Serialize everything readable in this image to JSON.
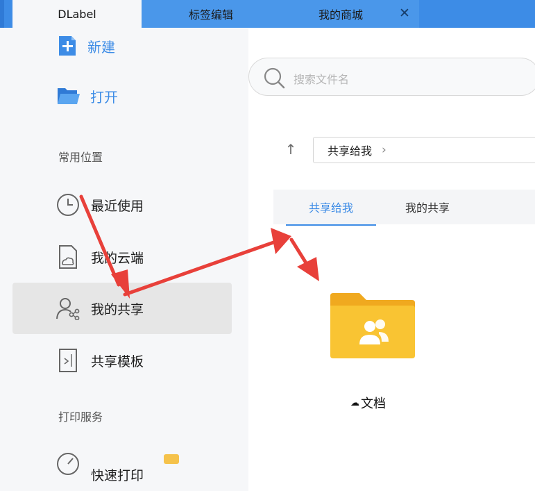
{
  "tabs": {
    "home": "DLabel",
    "label_edit": "标签编辑",
    "mall": "我的商城",
    "close_glyph": "✕"
  },
  "sidebar": {
    "new_label": "新建",
    "open_label": "打开",
    "section_common": "常用位置",
    "items": [
      {
        "label": "最近使用",
        "icon": "clock-icon"
      },
      {
        "label": "我的云端",
        "icon": "cloud-file-icon"
      },
      {
        "label": "我的共享",
        "icon": "share-user-icon",
        "selected": true
      },
      {
        "label": "共享模板",
        "icon": "template-icon"
      }
    ],
    "section_print": "打印服务",
    "fast_print_label": "快速打印"
  },
  "search": {
    "placeholder": "搜索文件名"
  },
  "nav": {
    "up_glyph": "↑",
    "breadcrumb": "共享给我",
    "breadcrumb_chevron": "›"
  },
  "subtabs": {
    "shared_with_me": "共享给我",
    "my_shares": "我的共享",
    "active": "shared_with_me"
  },
  "folder": {
    "name": "文档",
    "cloud_glyph": "☁"
  },
  "colors": {
    "accent": "#3d8ce6",
    "folder": "#f9c433",
    "annotation_arrow": "#e8403a"
  }
}
